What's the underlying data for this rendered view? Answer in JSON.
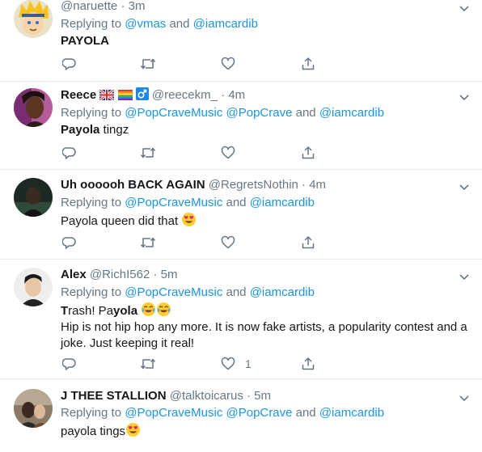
{
  "tweets": [
    {
      "name": "",
      "handle": "@naruette",
      "time": "3m",
      "reply_prefix": "Replying to",
      "mentions": [
        "@vmas",
        "@iamcardib"
      ],
      "joiners": [
        " and "
      ],
      "text": "PAYOLA",
      "like_count": ""
    },
    {
      "name": "Reece",
      "handle": "@reecekm_",
      "time": "4m",
      "reply_prefix": "Replying to",
      "mentions": [
        "@PopCraveMusic",
        "@PopCrave",
        "@iamcardib"
      ],
      "joiners": [
        " ",
        " and "
      ],
      "text_bold": "Payola",
      "text": " tingz",
      "like_count": ""
    },
    {
      "name": "Uh oooooh BACK AGAIN",
      "handle": "@RegretsNothin",
      "time": "4m",
      "reply_prefix": "Replying to",
      "mentions": [
        "@PopCraveMusic",
        "@iamcardib"
      ],
      "joiners": [
        " and "
      ],
      "text": "Payola queen did that",
      "like_count": ""
    },
    {
      "name": "Alex",
      "handle": "@RichI562",
      "time": "5m",
      "reply_prefix": "Replying to",
      "mentions": [
        "@PopCraveMusic",
        "@iamcardib"
      ],
      "joiners": [
        " and "
      ],
      "text_line1_a": "T",
      "text_line1_b": "rash! Pa",
      "text_line1_c": "yola",
      "text": "Hip is not hip hop any more. It is now fake artists, a popularity contest and a joke. Just keeping it real!",
      "like_count": "1"
    },
    {
      "name": "J THEE STALLION",
      "handle": "@talktoicarus",
      "time": "5m",
      "reply_prefix": "Replying to",
      "mentions": [
        "@PopCraveMusic",
        "@PopCrave",
        "@iamcardib"
      ],
      "joiners": [
        " ",
        " and "
      ],
      "text": "payola tings",
      "like_count": ""
    }
  ],
  "separator": "·",
  "colors": {
    "accent": "#1b95e0",
    "muted": "#657786",
    "border": "#e6ecf0"
  },
  "icons": [
    "reply-icon",
    "retweet-icon",
    "like-icon",
    "share-icon",
    "chevron-down-icon",
    "heart-eyes-emoji",
    "joy-emoji"
  ]
}
